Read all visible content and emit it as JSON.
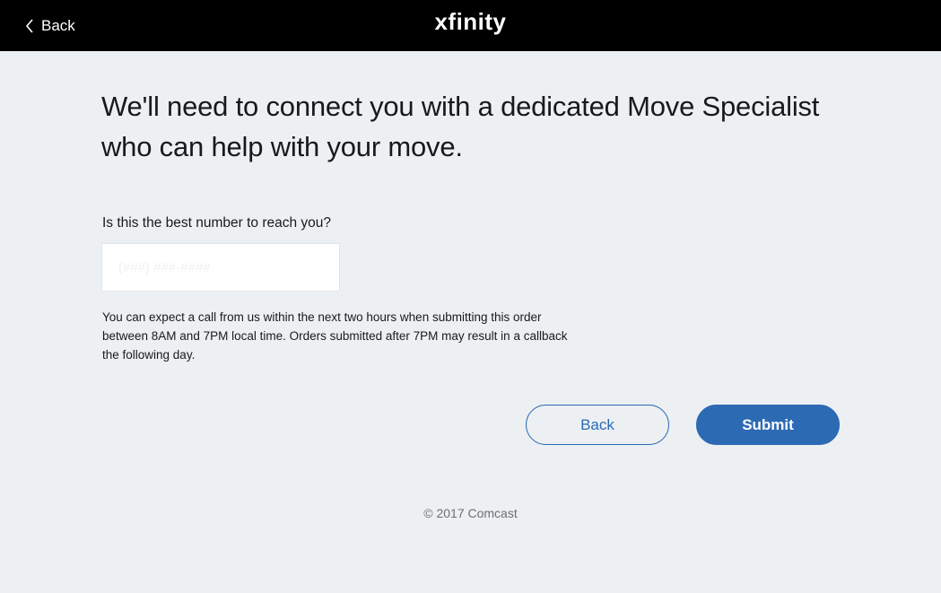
{
  "header": {
    "back_label": "Back",
    "logo_text": "xfinity"
  },
  "main": {
    "headline": "We'll need to connect you with a dedicated Move Specialist who can help with your move.",
    "question": "Is this the best number to reach you?",
    "phone_input": {
      "value": "",
      "placeholder": "(###) ###-####"
    },
    "note": "You can expect a call from us within the next two hours when submitting this order between 8AM and 7PM local time. Orders submitted after 7PM may result in a callback the following day.",
    "back_button": "Back",
    "submit_button": "Submit"
  },
  "footer": {
    "copyright": "© 2017 Comcast"
  },
  "colors": {
    "topbar": "#000000",
    "background": "#edf0f3",
    "accent": "#2d6ab4"
  }
}
